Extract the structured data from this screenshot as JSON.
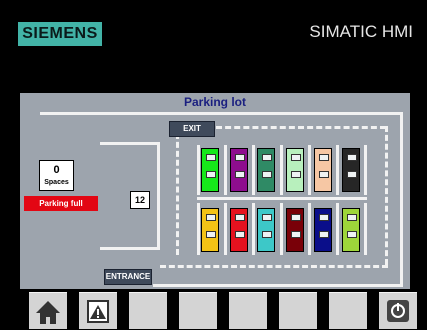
{
  "header": {
    "logo": "SIEMENS",
    "brand": "SIMATIC HMI"
  },
  "screen": {
    "title": "Parking lot",
    "exit_label": "EXIT",
    "entrance_label": "ENTRANCE",
    "spaces_value": "0",
    "spaces_label": "Spaces",
    "parking_full": "Parking full",
    "total_spaces": "12"
  },
  "cars": {
    "top_row": [
      "#16e81a",
      "#8e0d8e",
      "#2f8a65",
      "#b8f0bd",
      "#f6c7a4",
      "#262626"
    ],
    "bottom_row": [
      "#f3c316",
      "#e5121f",
      "#3dc8c8",
      "#790008",
      "#0a0e8a",
      "#9ed63a"
    ]
  },
  "function_keys": [
    "home-icon",
    "alarm-warning-icon",
    "",
    "",
    "",
    "",
    "",
    "power-icon"
  ]
}
